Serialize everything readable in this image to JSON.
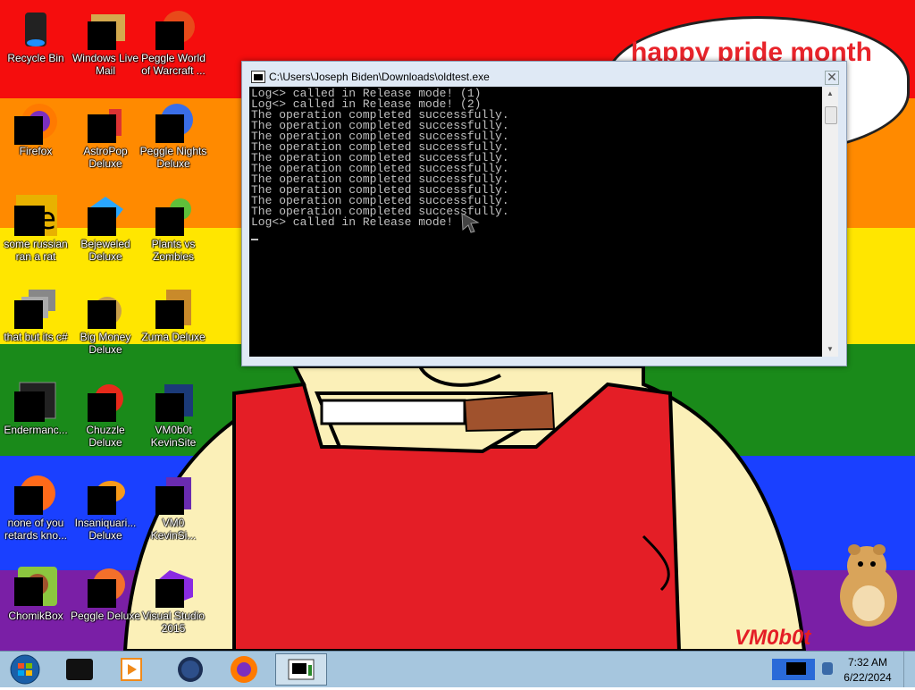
{
  "desktop": {
    "icons": [
      {
        "label": "Recycle Bin"
      },
      {
        "label": "Windows Live\nMail"
      },
      {
        "label": "Peggle World\nof Warcraft ..."
      },
      {
        "label": "Firefox"
      },
      {
        "label": "AstroPop\nDeluxe"
      },
      {
        "label": "Peggle Nights\nDeluxe"
      },
      {
        "label": "some russian\nran a rat"
      },
      {
        "label": "Bejeweled\nDeluxe"
      },
      {
        "label": "Plants vs\nZombies"
      },
      {
        "label": "that but its c#"
      },
      {
        "label": "Big Money\nDeluxe"
      },
      {
        "label": "Zuma Deluxe"
      },
      {
        "label": "Endermanc..."
      },
      {
        "label": "Chuzzle\nDeluxe"
      },
      {
        "label": "VM0b0t\nKevinSite"
      },
      {
        "label": "none of you\nretards kno..."
      },
      {
        "label": "Insaniquari...\nDeluxe"
      },
      {
        "label": "VM0\nKevinSi..."
      },
      {
        "label": "ChomikBox"
      },
      {
        "label": "Peggle Deluxe"
      },
      {
        "label": "Visual Studio\n2015"
      }
    ]
  },
  "wallpaper": {
    "bubble_text": "happy pride month",
    "signature": "VM0b0t",
    "band_colors": [
      "#f50d0d",
      "#ff8a00",
      "#ffe600",
      "#1a8a1a",
      "#1a40ff",
      "#7a1fa6"
    ]
  },
  "console": {
    "title": "C:\\Users\\Joseph Biden\\Downloads\\oldtest.exe",
    "close_label": "✕",
    "lines": [
      "Log<> called in Release mode! (1)",
      "Log<> called in Release mode! (2)",
      "The operation completed successfully.",
      "The operation completed successfully.",
      "The operation completed successfully.",
      "The operation completed successfully.",
      "The operation completed successfully.",
      "The operation completed successfully.",
      "The operation completed successfully.",
      "The operation completed successfully.",
      "The operation completed successfully.",
      "The operation completed successfully.",
      "Log<> called in Release mode!"
    ]
  },
  "taskbar": {
    "buttons": [
      {
        "name": "start-orb-icon"
      },
      {
        "name": "black-app-icon"
      },
      {
        "name": "media-player-icon"
      },
      {
        "name": "globe-icon"
      },
      {
        "name": "firefox-icon"
      },
      {
        "name": "console-task-icon"
      }
    ],
    "clock_time": "7:32 AM",
    "clock_date": "6/22/2024"
  }
}
